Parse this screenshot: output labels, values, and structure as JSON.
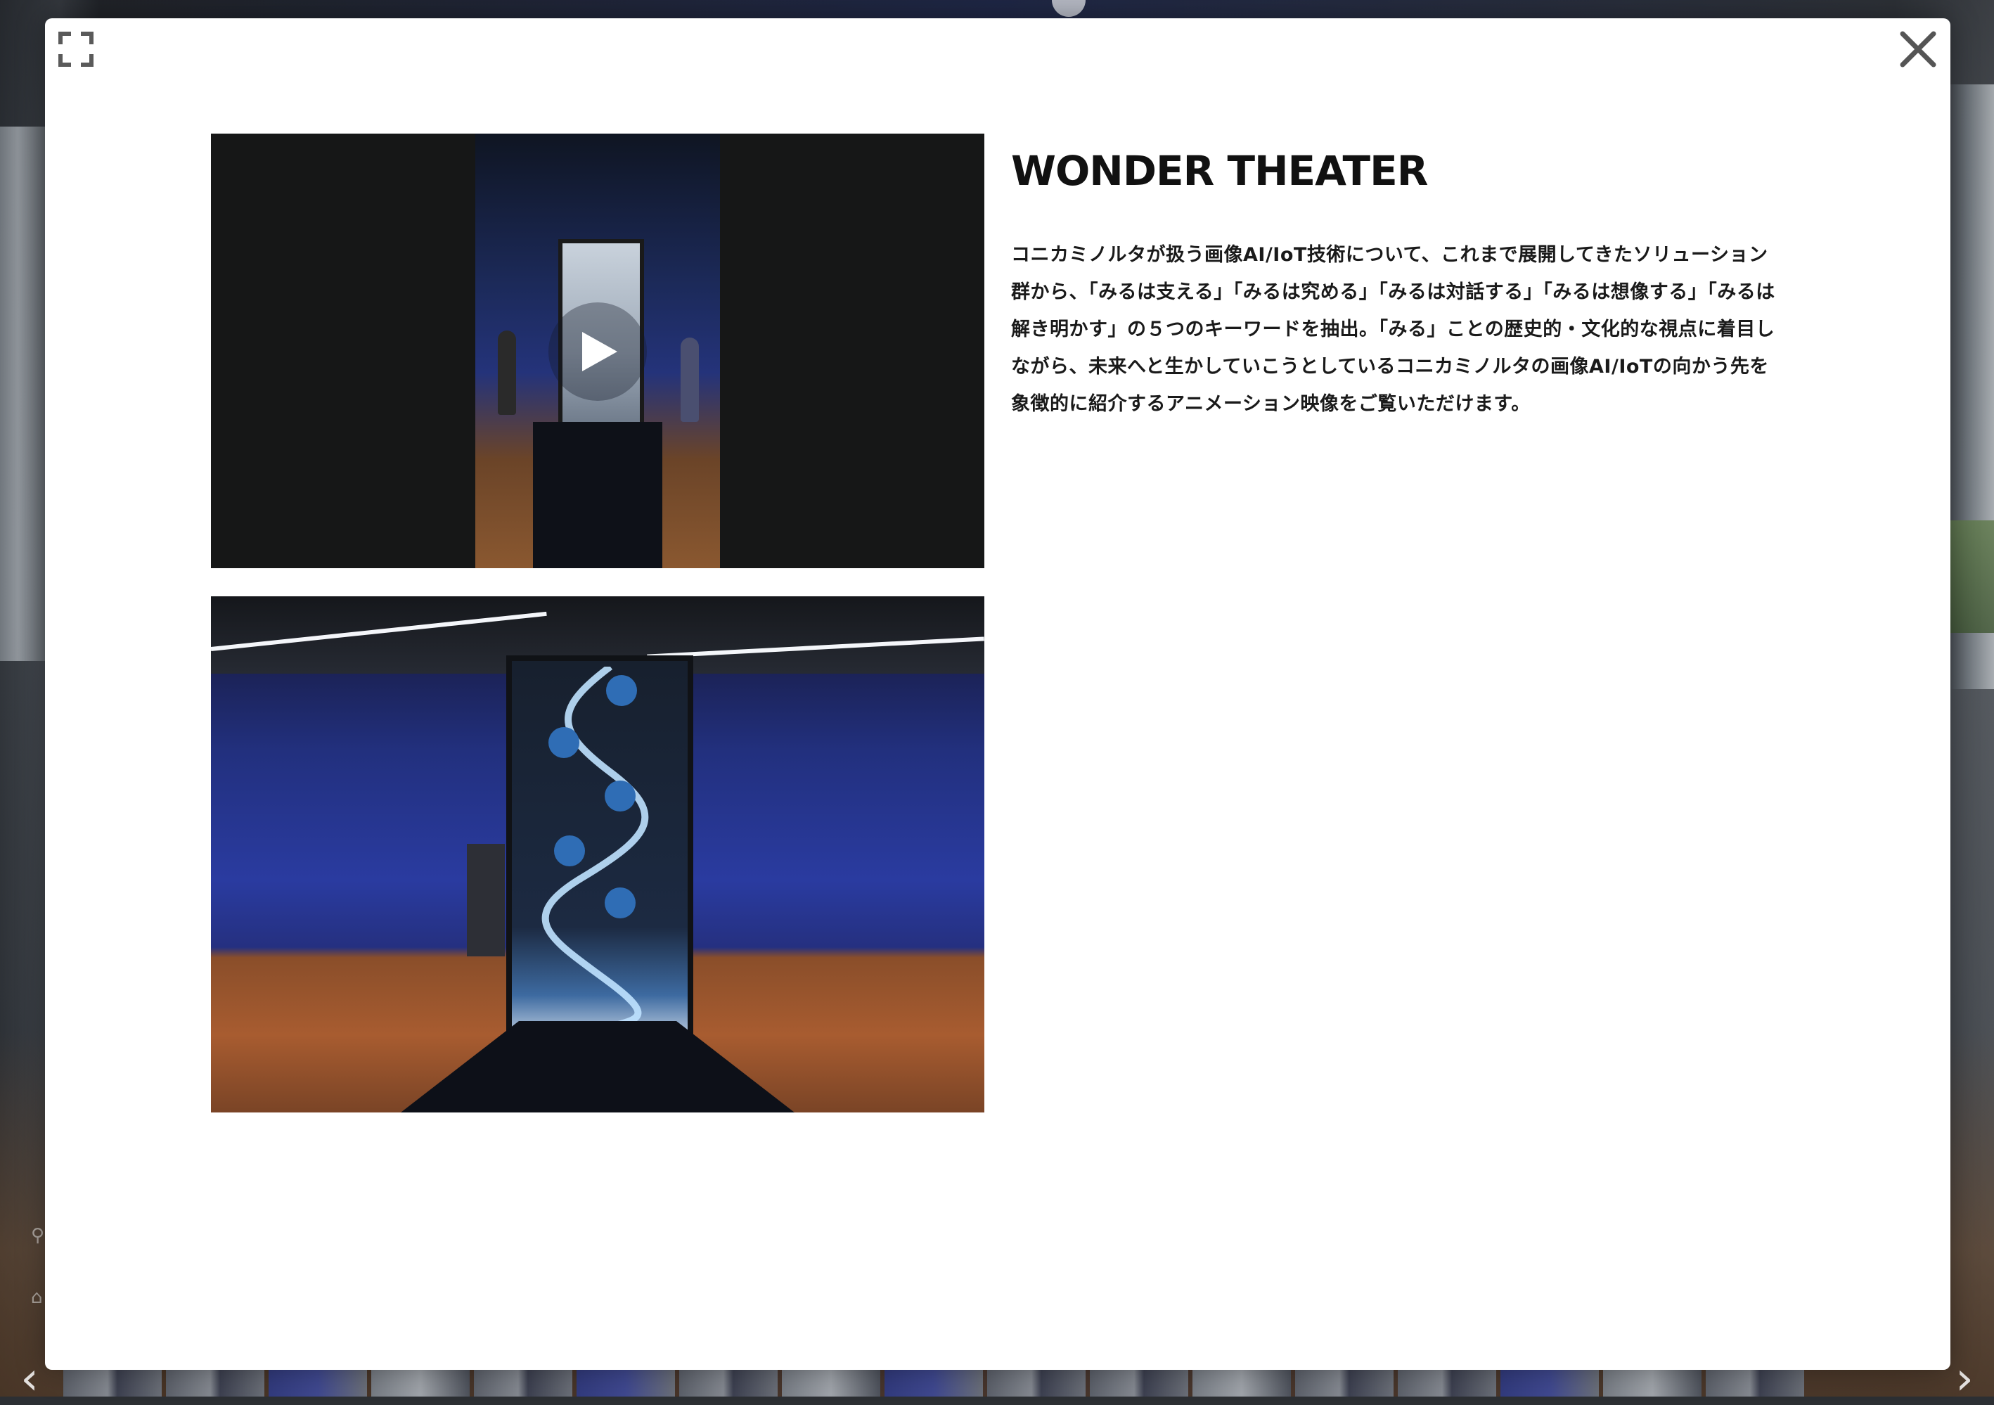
{
  "modal": {
    "title": "WONDER THEATER",
    "description": "コニカミノルタが扱う画像AI/IoT技術について、これまで展開してきたソリューション群から、「みるは支える」「みるは究める」「みるは対話する」「みるは想像する」「みるは解き明かす」の５つのキーワードを抽出。「みる」ことの歴史的・文化的な視点に着目しながら、未来へと生かしていこうとしているコニカミノルタの画像AI/IoTの向かう先を象徴的に紹介するアニメーション映像をご覧いただけます。",
    "fullscreen_icon": "fullscreen-icon",
    "close_icon": "close-icon",
    "video": {
      "play_icon": "play-icon",
      "state": "paused"
    },
    "image": {
      "subject": "wonder-theater-installation"
    }
  },
  "thumbnail_strip": {
    "prev_icon": "chevron-left-icon",
    "next_icon": "chevron-right-icon",
    "visible_count": 17
  },
  "colors": {
    "modal_background": "#ffffff",
    "video_background": "#161717",
    "title_text": "#111111",
    "body_text": "#1a1a1a",
    "wall_blue": "#2a3ba0"
  }
}
